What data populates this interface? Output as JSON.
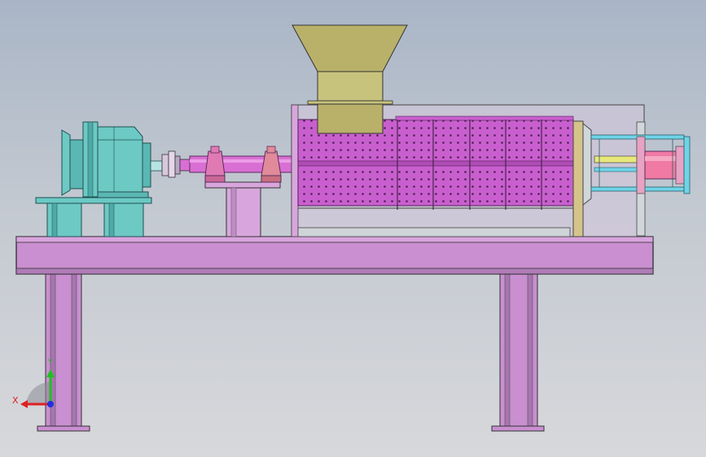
{
  "viewport": {
    "background_top": "#a9b5c6",
    "background_bottom": "#d7d8db"
  },
  "colors": {
    "frame": "#c98fd0",
    "frame_dark": "#8e5a98",
    "motor": "#6cc9c4",
    "motor_dark": "#2f7f80",
    "drum": "#c95fcf",
    "drum_hole": "#4d2250",
    "hopper": "#b9b16a",
    "hopper_dark": "#6c6630",
    "shaft": "#d96fd4",
    "bearing": "#e07ab5",
    "press_cyan": "#6fd4e8",
    "press_pink": "#f07aa3",
    "press_yellow": "#e8e87a"
  },
  "triad": {
    "x_label": "X",
    "y_label": "Y",
    "x_color": "#e02020",
    "y_color": "#20c020",
    "z_color": "#2030e0"
  }
}
